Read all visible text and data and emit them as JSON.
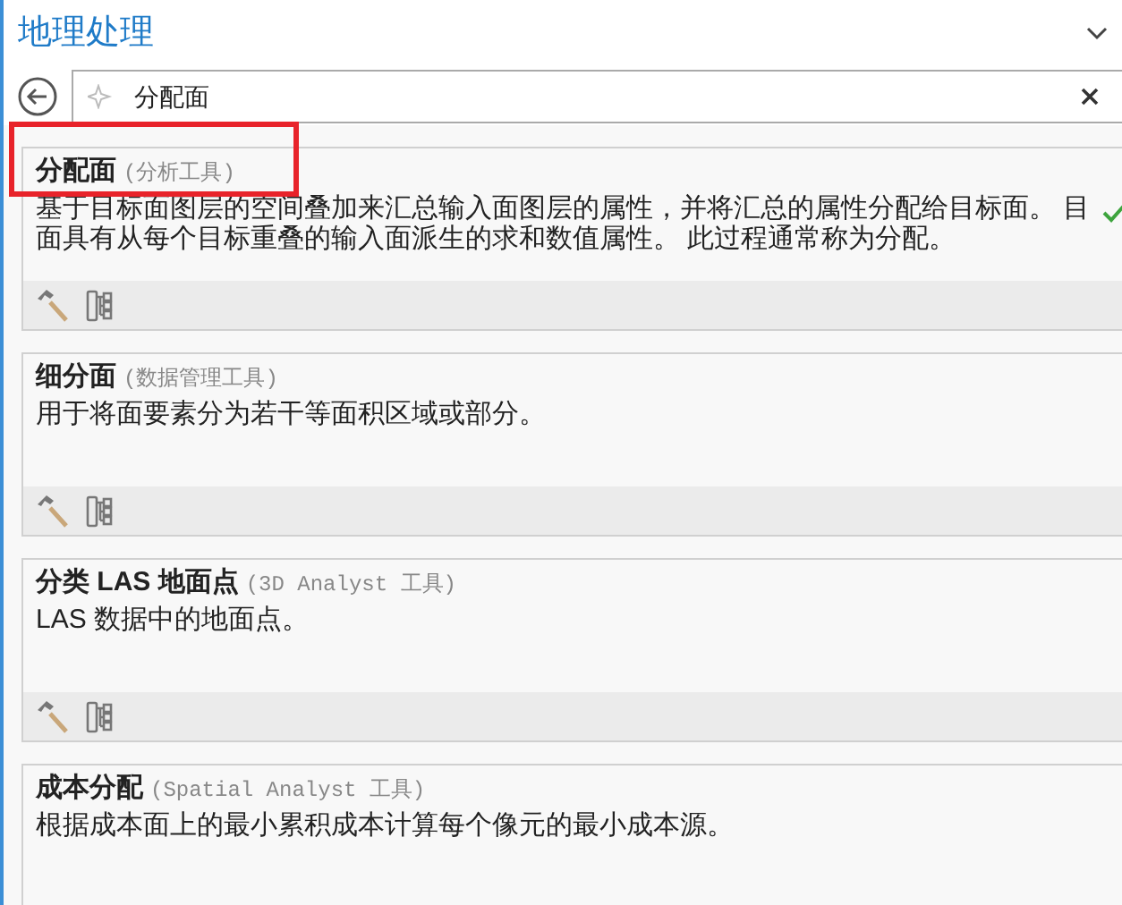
{
  "panel": {
    "title": "地理处理"
  },
  "search": {
    "value": "分配面"
  },
  "results": [
    {
      "name": "分配面",
      "toolbox": "(分析工具)",
      "highlighted": true,
      "checked": true,
      "description": [
        "基于目标面图层的空间叠加来汇总输入面图层的属性，并将汇总的属性分配给目标面。 目",
        "面具有从每个目标重叠的输入面派生的求和数值属性。 此过程通常称为分配。"
      ]
    },
    {
      "name": "细分面",
      "toolbox": "(数据管理工具)",
      "highlighted": false,
      "checked": false,
      "description": [
        "用于将面要素分为若干等面积区域或部分。"
      ]
    },
    {
      "name": "分类 LAS 地面点",
      "toolbox": "(3D Analyst 工具)",
      "highlighted": false,
      "checked": false,
      "description": [
        "LAS 数据中的地面点。"
      ]
    },
    {
      "name": "成本分配",
      "toolbox": "(Spatial Analyst 工具)",
      "highlighted": false,
      "checked": false,
      "description": [
        "根据成本面上的最小累积成本计算每个像元的最小成本源。"
      ]
    }
  ]
}
